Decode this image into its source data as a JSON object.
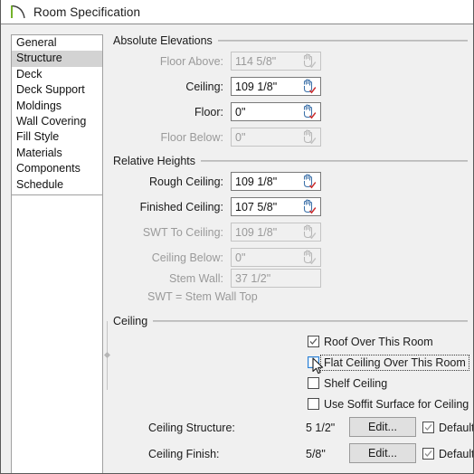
{
  "window": {
    "title": "Room Specification",
    "icon": "room-arc-icon"
  },
  "sidebar": {
    "items": [
      {
        "label": "General",
        "selected": false
      },
      {
        "label": "Structure",
        "selected": true
      },
      {
        "label": "Deck",
        "selected": false
      },
      {
        "label": "Deck Support",
        "selected": false
      },
      {
        "label": "Moldings",
        "selected": false
      },
      {
        "label": "Wall Covering",
        "selected": false
      },
      {
        "label": "Fill Style",
        "selected": false
      },
      {
        "label": "Materials",
        "selected": false
      },
      {
        "label": "Components",
        "selected": false
      },
      {
        "label": "Schedule",
        "selected": false
      }
    ]
  },
  "groups": {
    "absolute_elevations": {
      "title": "Absolute Elevations",
      "fields": [
        {
          "label": "Floor Above:",
          "value": "114 5/8\"",
          "disabled": true,
          "spinner": true
        },
        {
          "label": "Ceiling:",
          "value": "109 1/8\"",
          "disabled": false,
          "spinner": true
        },
        {
          "label": "Floor:",
          "value": "0\"",
          "disabled": false,
          "spinner": true
        },
        {
          "label": "Floor Below:",
          "value": "0\"",
          "disabled": true,
          "spinner": true
        }
      ]
    },
    "relative_heights": {
      "title": "Relative Heights",
      "fields": [
        {
          "label": "Rough Ceiling:",
          "value": "109 1/8\"",
          "disabled": false,
          "spinner": true
        },
        {
          "label": "Finished Ceiling:",
          "value": "107 5/8\"",
          "disabled": false,
          "spinner": true
        },
        {
          "label": "SWT To Ceiling:",
          "value": "109 1/8\"",
          "disabled": true,
          "spinner": true
        },
        {
          "label": "Ceiling Below:",
          "value": "0\"",
          "disabled": true,
          "spinner": true
        },
        {
          "label": "Stem Wall:",
          "value": "37 1/2\"",
          "disabled": true,
          "spinner": false
        }
      ],
      "footnote": "SWT = Stem Wall Top"
    },
    "ceiling": {
      "title": "Ceiling",
      "checkboxes": [
        {
          "label": "Roof Over This Room",
          "checked": true,
          "focused": false,
          "hovered": false
        },
        {
          "label": "Flat Ceiling Over This Room",
          "checked": false,
          "focused": true,
          "hovered": true
        },
        {
          "label": "Shelf Ceiling",
          "checked": false,
          "focused": false,
          "hovered": false
        },
        {
          "label": "Use Soffit Surface for Ceiling",
          "checked": false,
          "focused": false,
          "hovered": false
        }
      ],
      "edit_rows": [
        {
          "label": "Ceiling Structure:",
          "value": "5 1/2\"",
          "button": "Edit...",
          "default_label": "Default",
          "default_checked": true
        },
        {
          "label": "Ceiling Finish:",
          "value": "5/8\"",
          "button": "Edit...",
          "default_label": "Default",
          "default_checked": true
        }
      ]
    }
  },
  "colors": {
    "accent_blue": "#2a7fd4",
    "check_red": "#cc2b2b",
    "icon_blue": "#3a6fa8",
    "selection": "#d3d3d3",
    "window_bg": "#f0f0f0"
  }
}
